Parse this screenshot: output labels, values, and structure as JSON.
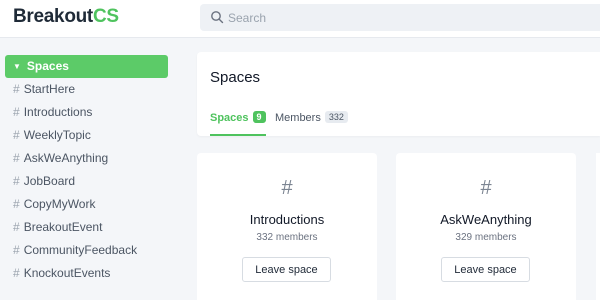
{
  "brand": {
    "name_part1": "Breakout",
    "name_part2": "CS",
    "accent": "#4fc35e"
  },
  "search": {
    "placeholder": "Search"
  },
  "sidebar": {
    "active": {
      "label": "Spaces"
    },
    "items": [
      {
        "label": "StartHere"
      },
      {
        "label": "Introductions"
      },
      {
        "label": "WeeklyTopic"
      },
      {
        "label": "AskWeAnything"
      },
      {
        "label": "JobBoard"
      },
      {
        "label": "CopyMyWork"
      },
      {
        "label": "BreakoutEvent"
      },
      {
        "label": "CommunityFeedback"
      },
      {
        "label": "KnockoutEvents"
      }
    ]
  },
  "main": {
    "title": "Spaces",
    "tabs": [
      {
        "label": "Spaces",
        "count": "9"
      },
      {
        "label": "Members",
        "count": "332"
      }
    ],
    "cards": [
      {
        "name": "Introductions",
        "members": "332 members",
        "button": "Leave space"
      },
      {
        "name": "AskWeAnything",
        "members": "329 members",
        "button": "Leave space"
      }
    ]
  }
}
